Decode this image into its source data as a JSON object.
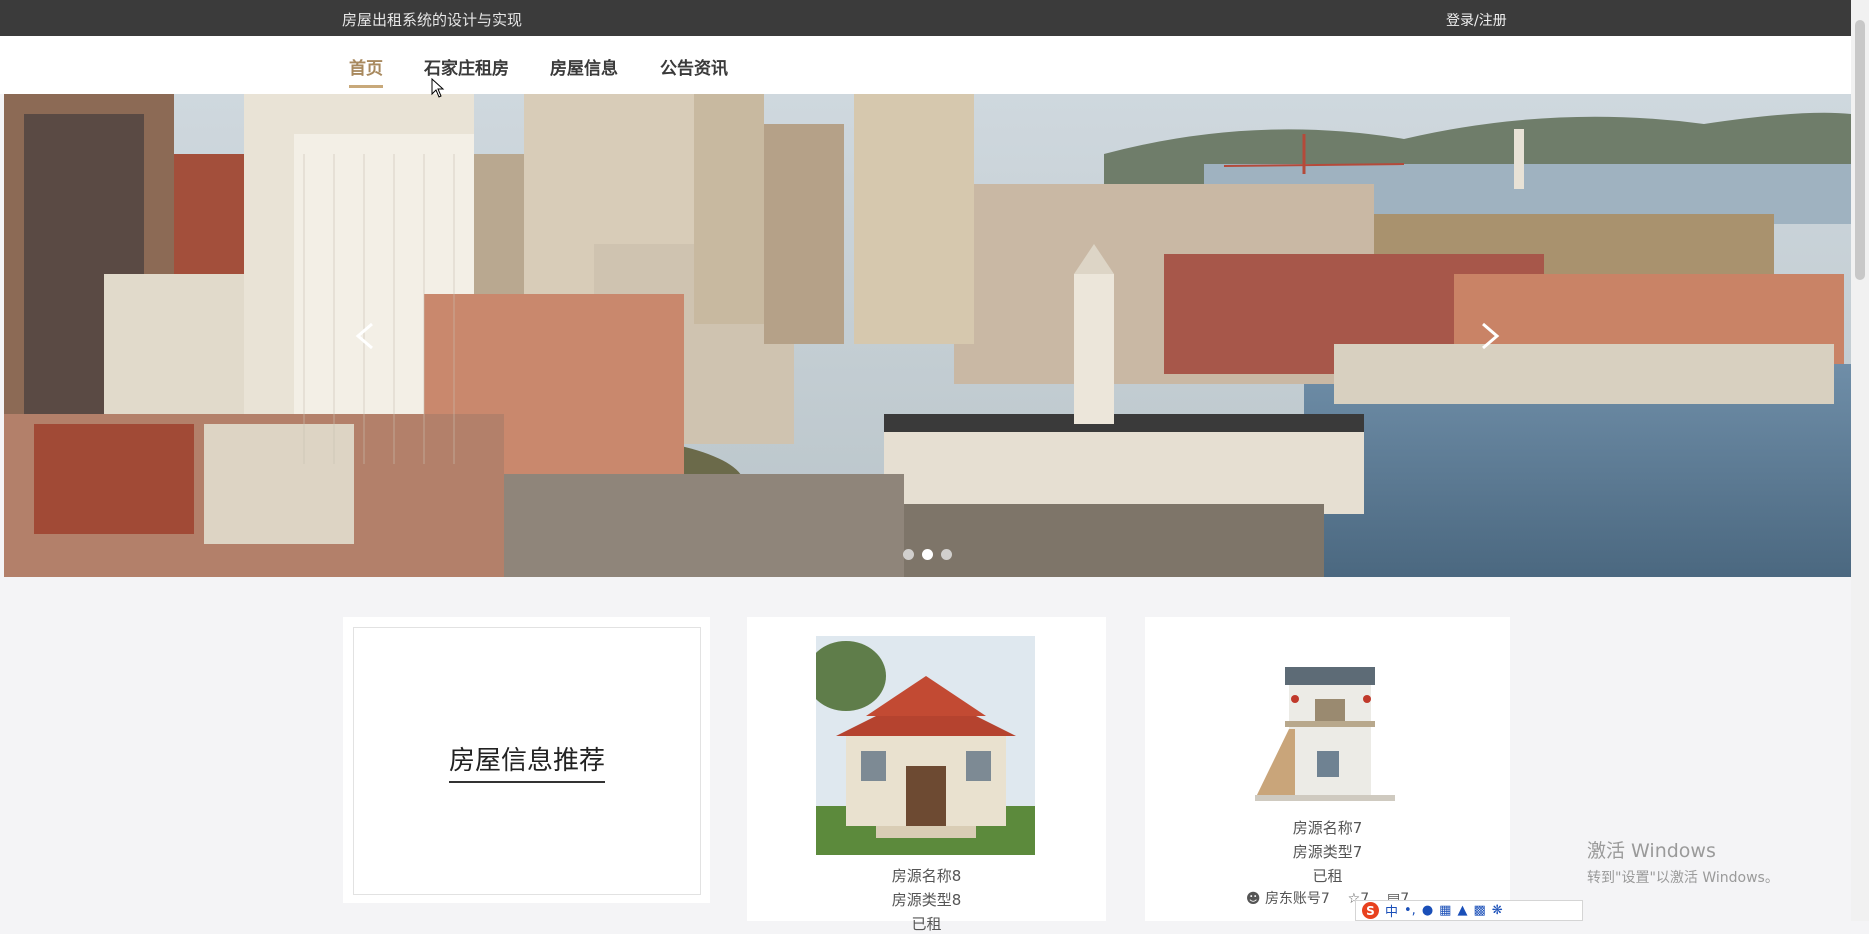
{
  "header": {
    "site_title": "房屋出租系统的设计与实现",
    "login_label": "登录/注册"
  },
  "nav": {
    "items": [
      {
        "label": "首页",
        "active": true
      },
      {
        "label": "石家庄租房",
        "active": false
      },
      {
        "label": "房屋信息",
        "active": false
      },
      {
        "label": "公告资讯",
        "active": false
      }
    ]
  },
  "banner": {
    "image": "city-waterfront-photo",
    "slide_count": 3,
    "active_slide": 2
  },
  "recommend": {
    "title": "房屋信息推荐"
  },
  "listings": [
    {
      "name": "房源名称8",
      "type": "房源类型8",
      "status": "已租",
      "image": "villa-photo"
    },
    {
      "name": "房源名称7",
      "type": "房源类型7",
      "status": "已租",
      "owner": "房东账号7",
      "favorites": "7",
      "comments": "7",
      "image": "small-house-photo"
    }
  ],
  "system": {
    "watermark_line1": "激活 Windows",
    "watermark_line2": "转到\"设置\"以激活 Windows。",
    "ime_label": "中"
  }
}
